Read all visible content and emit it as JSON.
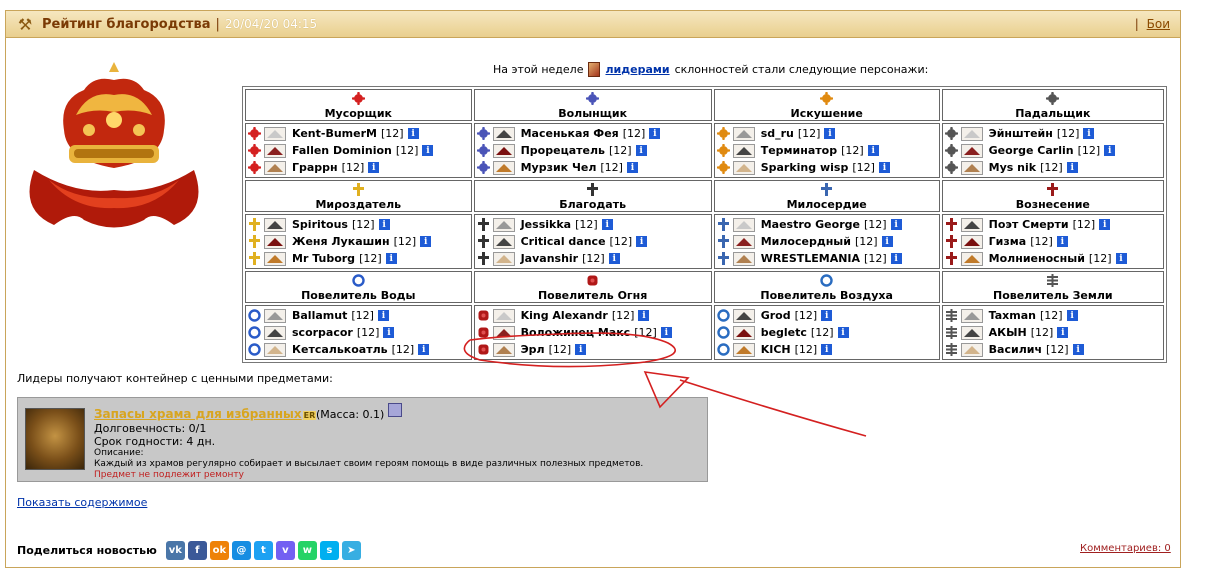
{
  "header": {
    "title": "Рейтинг благородства",
    "date": "20/04/20 04:15",
    "right_link": "Бои"
  },
  "intro": {
    "prefix": "На этой неделе",
    "link": "лидерами",
    "suffix": "склонностей стали следующие персонажи:"
  },
  "groups": [
    {
      "name": "Мусорщик",
      "members": [
        {
          "name": "Kent-BumerM",
          "level": "[12]"
        },
        {
          "name": "Fallen Dominion",
          "level": "[12]"
        },
        {
          "name": "Граррн",
          "level": "[12]"
        }
      ]
    },
    {
      "name": "Волынщик",
      "members": [
        {
          "name": "Масенькая Фея",
          "level": "[12]"
        },
        {
          "name": "Прорецатель",
          "level": "[12]"
        },
        {
          "name": "Мурзик Чел",
          "level": "[12]"
        }
      ]
    },
    {
      "name": "Искушение",
      "members": [
        {
          "name": "sd_ru",
          "level": "[12]"
        },
        {
          "name": "Терминатор",
          "level": "[12]"
        },
        {
          "name": "Sparking wisp",
          "level": "[12]"
        }
      ]
    },
    {
      "name": "Падальщик",
      "members": [
        {
          "name": "Эйнштейн",
          "level": "[12]"
        },
        {
          "name": "George Carlin",
          "level": "[12]"
        },
        {
          "name": "Mys nik",
          "level": "[12]"
        }
      ]
    },
    {
      "name": "Миροздатель",
      "members": [
        {
          "name": "Spiritous",
          "level": "[12]"
        },
        {
          "name": "Женя Лукашин",
          "level": "[12]"
        },
        {
          "name": "Mr Tuborg",
          "level": "[12]"
        }
      ]
    },
    {
      "name": "Благодать",
      "members": [
        {
          "name": "Jessikka",
          "level": "[12]"
        },
        {
          "name": "Critical dance",
          "level": "[12]"
        },
        {
          "name": "Javanshir",
          "level": "[12]"
        }
      ]
    },
    {
      "name": "Милосердие",
      "members": [
        {
          "name": "Maestro George",
          "level": "[12]"
        },
        {
          "name": "Милосердный",
          "level": "[12]"
        },
        {
          "name": "WRESTLEMANIA",
          "level": "[12]"
        }
      ]
    },
    {
      "name": "Вознесение",
      "members": [
        {
          "name": "Поэт Смерти",
          "level": "[12]"
        },
        {
          "name": "Гизма",
          "level": "[12]"
        },
        {
          "name": "Молниеносный",
          "level": "[12]"
        }
      ]
    },
    {
      "name": "Повелитель Воды",
      "members": [
        {
          "name": "Ballamut",
          "level": "[12]"
        },
        {
          "name": "scorpacor",
          "level": "[12]"
        },
        {
          "name": "Кетсалькоатль",
          "level": "[12]"
        }
      ]
    },
    {
      "name": "Повелитель Огня",
      "members": [
        {
          "name": "King Alexandr",
          "level": "[12]"
        },
        {
          "name": "Воложинец Макс",
          "level": "[12]"
        },
        {
          "name": "Эрл",
          "level": "[12]"
        }
      ]
    },
    {
      "name": "Повелитель Воздуха",
      "members": [
        {
          "name": "Grod",
          "level": "[12]"
        },
        {
          "name": "begletc",
          "level": "[12]"
        },
        {
          "name": "KICH",
          "level": "[12]"
        }
      ]
    },
    {
      "name": "Повелитель Земли",
      "members": [
        {
          "name": "Taxman",
          "level": "[12]"
        },
        {
          "name": "АКЫН",
          "level": "[12]"
        },
        {
          "name": "Василич",
          "level": "[12]"
        }
      ]
    }
  ],
  "leaders_note": "Лидеры получают контейнер с ценными предметами:",
  "item": {
    "name": "Запасы храма для избранных",
    "tag": "ER",
    "mass": "(Масса: 0.1)",
    "durability": "Долговечность: 0/1",
    "expiry": "Срок годности: 4 дн.",
    "desc_label": "Описание:",
    "description": "Каждый из храмов регулярно собирает и высылает своим героям помощь в виде различных полезных предметов.",
    "repair_note": "Предмет не подлежит ремонту"
  },
  "show_contents": "Показать содержимое",
  "share": {
    "label": "Поделиться новостью",
    "buttons": [
      {
        "icon": "vk-icon",
        "glyph": "vk",
        "color": "#4a76a8"
      },
      {
        "icon": "facebook-icon",
        "glyph": "f",
        "color": "#3b5998"
      },
      {
        "icon": "odnoklassniki-icon",
        "glyph": "ok",
        "color": "#ee8208"
      },
      {
        "icon": "moimir-icon",
        "glyph": "@",
        "color": "#168de2"
      },
      {
        "icon": "twitter-icon",
        "glyph": "t",
        "color": "#1da1f2"
      },
      {
        "icon": "viber-icon",
        "glyph": "v",
        "color": "#7360f2"
      },
      {
        "icon": "whatsapp-icon",
        "glyph": "w",
        "color": "#25d366"
      },
      {
        "icon": "skype-icon",
        "glyph": "s",
        "color": "#00aff0"
      },
      {
        "icon": "telegram-icon",
        "glyph": "➤",
        "color": "#37aee2"
      }
    ]
  },
  "comments": "Комментариев: 0",
  "colors": {
    "accent": "#7a3a05",
    "header_bg": "#efdcae",
    "link": "#0033aa",
    "info_icon": "#1e5bd6"
  }
}
